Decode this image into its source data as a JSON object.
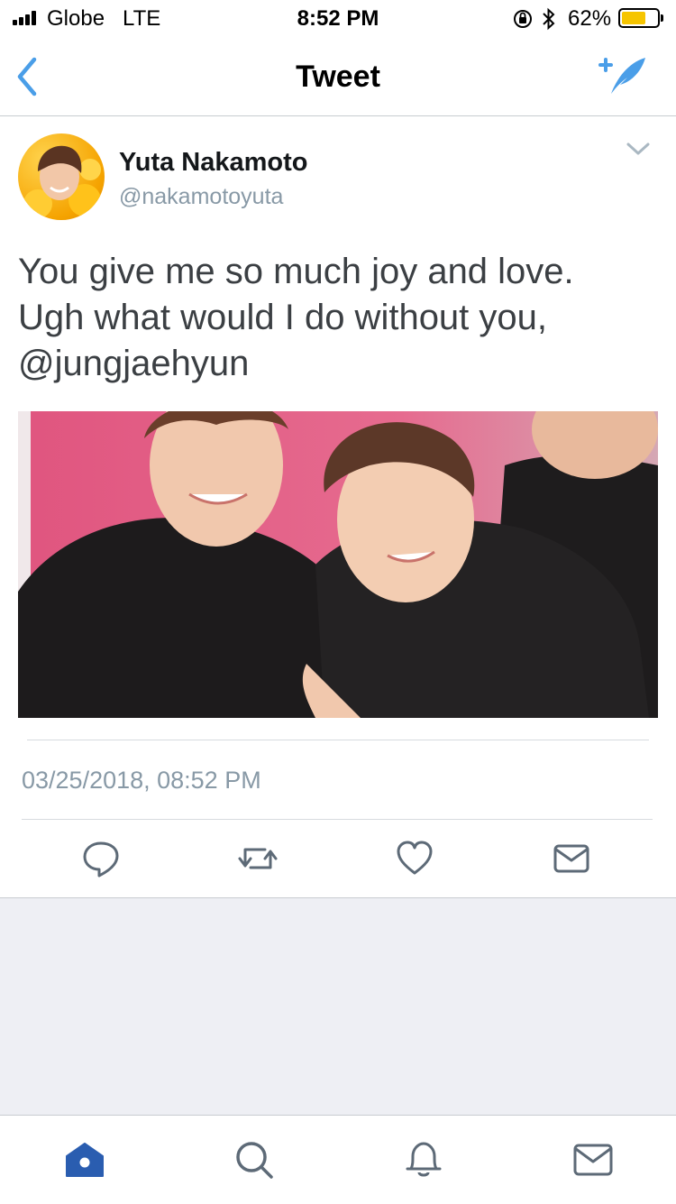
{
  "status_bar": {
    "carrier": "Globe",
    "network": "LTE",
    "time": "8:52 PM",
    "battery": "62%",
    "battery_level": 0.62,
    "icons": [
      "signal-icon",
      "orientation-lock-icon",
      "bluetooth-icon",
      "battery-icon"
    ]
  },
  "nav": {
    "title": "Tweet",
    "back_icon": "chevron-left-icon",
    "compose_icon": "compose-tweet-icon"
  },
  "tweet": {
    "author_name": "Yuta Nakamoto",
    "author_handle": "@nakamotoyuta",
    "text": "You give me so much joy and love.\nUgh what would I do without you,\n@jungjaehyun",
    "timestamp": "03/25/2018, 08:52 PM",
    "menu_icon": "chevron-down-icon"
  },
  "actions": [
    "reply-icon",
    "retweet-icon",
    "like-icon",
    "direct-message-icon"
  ],
  "tab_bar": [
    "home-icon",
    "search-icon",
    "notifications-icon",
    "messages-icon"
  ],
  "colors": {
    "accent": "#4a9ee8",
    "tab_active": "#2a5db0",
    "icon_gray": "#5d6a77",
    "battery": "#f6c500"
  }
}
